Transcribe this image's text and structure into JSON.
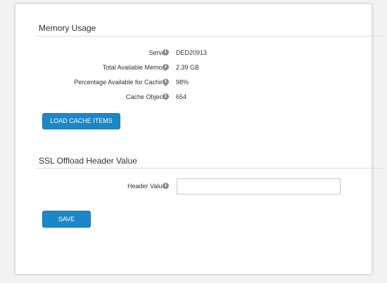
{
  "memory": {
    "title": "Memory Usage",
    "rows": [
      {
        "label": "Server",
        "value": "DED20913"
      },
      {
        "label": "Total Available Memory",
        "value": "2.39 GB"
      },
      {
        "label": "Percentage Available for Caching",
        "value": "98%"
      },
      {
        "label": "Cache Objects",
        "value": "654"
      }
    ],
    "load_button": "LOAD CACHE ITEMS"
  },
  "ssl": {
    "title": "SSL Offload Header Value",
    "header_label": "Header Value:",
    "header_value": "",
    "save_button": "SAVE"
  }
}
